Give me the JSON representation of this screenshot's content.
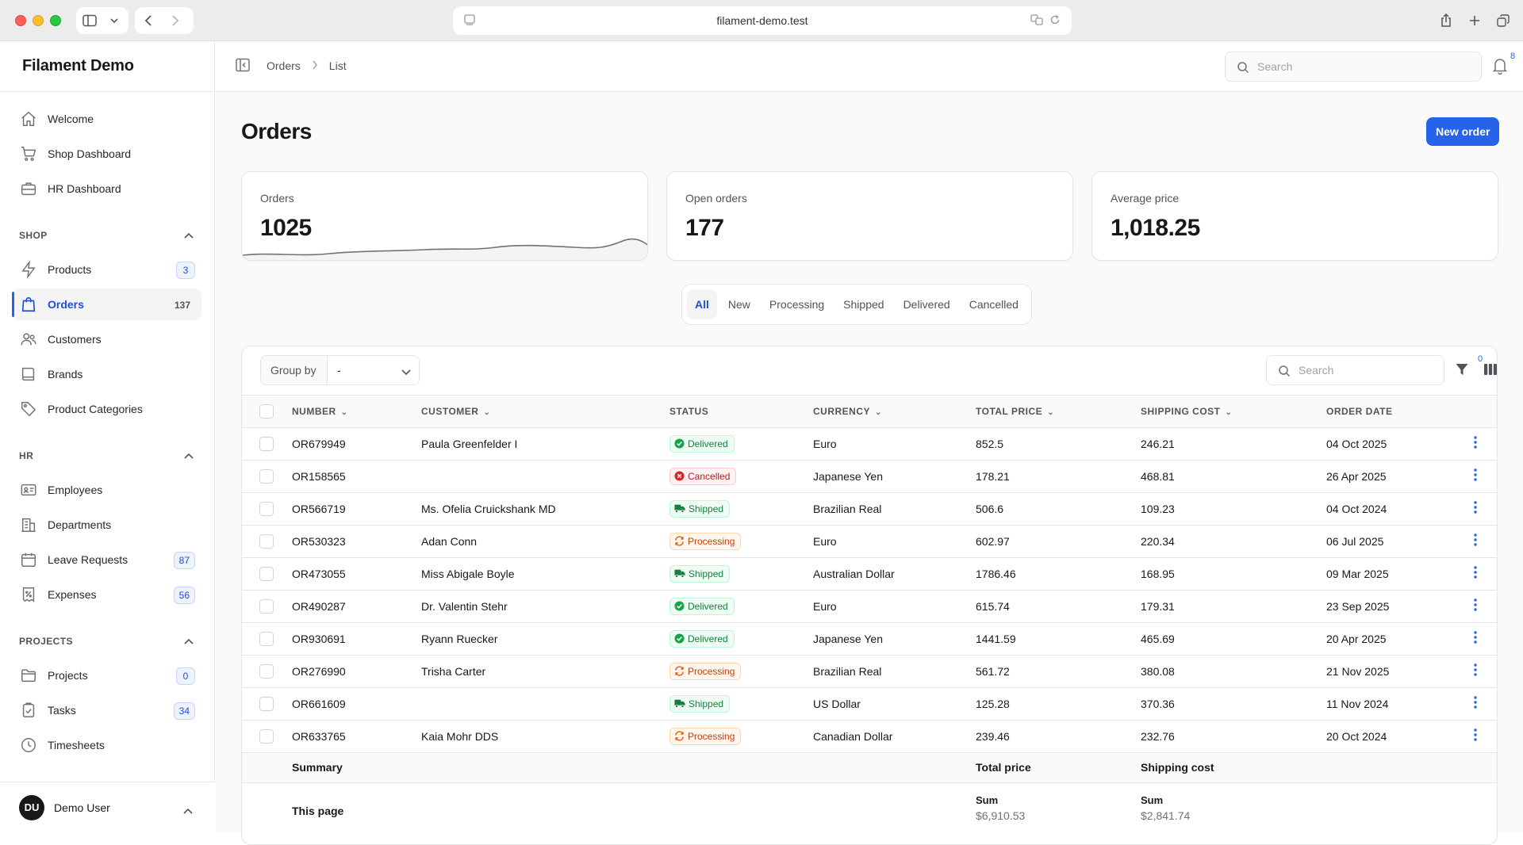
{
  "browser": {
    "url": "filament-demo.test"
  },
  "sidebar": {
    "brand": "Filament Demo",
    "top_items": [
      {
        "label": "Welcome"
      },
      {
        "label": "Shop Dashboard"
      },
      {
        "label": "HR Dashboard"
      }
    ],
    "groups": {
      "shop": {
        "title": "SHOP",
        "items": [
          {
            "label": "Products",
            "badge": "3"
          },
          {
            "label": "Orders",
            "badge": "137"
          },
          {
            "label": "Customers"
          },
          {
            "label": "Brands"
          },
          {
            "label": "Product Categories"
          }
        ]
      },
      "hr": {
        "title": "HR",
        "items": [
          {
            "label": "Employees"
          },
          {
            "label": "Departments"
          },
          {
            "label": "Leave Requests",
            "badge": "87"
          },
          {
            "label": "Expenses",
            "badge": "56"
          }
        ]
      },
      "projects": {
        "title": "PROJECTS",
        "items": [
          {
            "label": "Projects",
            "badge": "0"
          },
          {
            "label": "Tasks",
            "badge": "34"
          },
          {
            "label": "Timesheets"
          }
        ]
      }
    },
    "user": {
      "initials": "DU",
      "name": "Demo User"
    }
  },
  "topbar": {
    "breadcrumbs": [
      "Orders",
      "List"
    ],
    "search_placeholder": "Search",
    "notification_count": "8"
  },
  "page": {
    "title": "Orders",
    "new_button": "New order"
  },
  "stats": [
    {
      "label": "Orders",
      "value": "1025"
    },
    {
      "label": "Open orders",
      "value": "177"
    },
    {
      "label": "Average price",
      "value": "1,018.25"
    }
  ],
  "tabs": [
    "All",
    "New",
    "Processing",
    "Shipped",
    "Delivered",
    "Cancelled"
  ],
  "table": {
    "group_by_label": "Group by",
    "group_by_value": "-",
    "search_placeholder": "Search",
    "filter_count": "0",
    "columns": [
      "NUMBER",
      "CUSTOMER",
      "STATUS",
      "CURRENCY",
      "TOTAL PRICE",
      "SHIPPING COST",
      "ORDER DATE"
    ],
    "rows": [
      {
        "number": "OR679949",
        "customer": "Paula Greenfelder I",
        "status": "Delivered",
        "currency": "Euro",
        "total": "852.5",
        "shipping": "246.21",
        "date": "04 Oct 2025"
      },
      {
        "number": "OR158565",
        "customer": "",
        "status": "Cancelled",
        "currency": "Japanese Yen",
        "total": "178.21",
        "shipping": "468.81",
        "date": "26 Apr 2025"
      },
      {
        "number": "OR566719",
        "customer": "Ms. Ofelia Cruickshank MD",
        "status": "Shipped",
        "currency": "Brazilian Real",
        "total": "506.6",
        "shipping": "109.23",
        "date": "04 Oct 2024"
      },
      {
        "number": "OR530323",
        "customer": "Adan Conn",
        "status": "Processing",
        "currency": "Euro",
        "total": "602.97",
        "shipping": "220.34",
        "date": "06 Jul 2025"
      },
      {
        "number": "OR473055",
        "customer": "Miss Abigale Boyle",
        "status": "Shipped",
        "currency": "Australian Dollar",
        "total": "1786.46",
        "shipping": "168.95",
        "date": "09 Mar 2025"
      },
      {
        "number": "OR490287",
        "customer": "Dr. Valentin Stehr",
        "status": "Delivered",
        "currency": "Euro",
        "total": "615.74",
        "shipping": "179.31",
        "date": "23 Sep 2025"
      },
      {
        "number": "OR930691",
        "customer": "Ryann Ruecker",
        "status": "Delivered",
        "currency": "Japanese Yen",
        "total": "1441.59",
        "shipping": "465.69",
        "date": "20 Apr 2025"
      },
      {
        "number": "OR276990",
        "customer": "Trisha Carter",
        "status": "Processing",
        "currency": "Brazilian Real",
        "total": "561.72",
        "shipping": "380.08",
        "date": "21 Nov 2025"
      },
      {
        "number": "OR661609",
        "customer": "",
        "status": "Shipped",
        "currency": "US Dollar",
        "total": "125.28",
        "shipping": "370.36",
        "date": "11 Nov 2024"
      },
      {
        "number": "OR633765",
        "customer": "Kaia Mohr DDS",
        "status": "Processing",
        "currency": "Canadian Dollar",
        "total": "239.46",
        "shipping": "232.76",
        "date": "20 Oct 2024"
      }
    ],
    "summary": {
      "label": "Summary",
      "total_header": "Total price",
      "shipping_header": "Shipping cost",
      "page_label": "This page",
      "sum_label": "Sum",
      "total_sum": "$6,910.53",
      "shipping_sum": "$2,841.74"
    }
  },
  "colors": {
    "accent": "#2563eb",
    "delivered": "#15803d",
    "cancelled": "#b91c1c",
    "processing": "#c2410c"
  }
}
